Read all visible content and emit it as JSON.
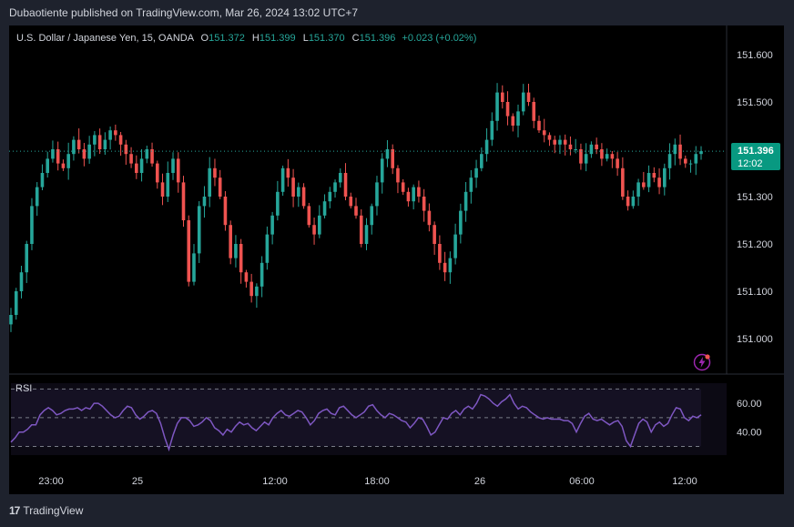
{
  "header": {
    "publisher_line": "Dubaotiente published on TradingView.com, Mar 26, 2024 13:02 UTC+7"
  },
  "legend": {
    "symbol": "U.S. Dollar / Japanese Yen, 15, OANDA",
    "o_label": "O",
    "o_value": "151.372",
    "h_label": "H",
    "h_value": "151.399",
    "l_label": "L",
    "l_value": "151.370",
    "c_label": "C",
    "c_value": "151.396",
    "change": "+0.023 (+0.02%)"
  },
  "price_tag": {
    "price": "151.396",
    "countdown": "12:02"
  },
  "rsi": {
    "label": "RSI"
  },
  "footer": {
    "brand": "TradingView"
  },
  "colors": {
    "up": "#26a69a",
    "down": "#ef5350",
    "rsi_line": "#7e57c2",
    "background": "#000000",
    "frame": "#1e222d",
    "text": "#d1d4dc"
  },
  "chart_data": [
    {
      "type": "candlestick",
      "title": "U.S. Dollar / Japanese Yen, 15, OANDA",
      "y_ticks": [
        "151.600",
        "151.500",
        "151.300",
        "151.200",
        "151.100",
        "151.000"
      ],
      "ylim": [
        150.93,
        151.68
      ],
      "x_ticks": [
        "23:00",
        "25",
        "12:00",
        "18:00",
        "26",
        "06:00",
        "12:00"
      ],
      "last_price": 151.396,
      "last_price_line": "dotted",
      "close_series": [
        151.05,
        151.1,
        151.14,
        151.2,
        151.28,
        151.32,
        151.35,
        151.38,
        151.4,
        151.37,
        151.36,
        151.39,
        151.42,
        151.4,
        151.38,
        151.41,
        151.43,
        151.4,
        151.42,
        151.44,
        151.43,
        151.41,
        151.39,
        151.37,
        151.35,
        151.38,
        151.4,
        151.37,
        151.33,
        151.3,
        151.35,
        151.38,
        151.33,
        151.25,
        151.12,
        151.18,
        151.28,
        151.3,
        151.36,
        151.34,
        151.3,
        151.24,
        151.17,
        151.2,
        151.14,
        151.12,
        151.09,
        151.11,
        151.16,
        151.22,
        151.26,
        151.31,
        151.36,
        151.34,
        151.3,
        151.32,
        151.28,
        151.24,
        151.22,
        151.26,
        151.29,
        151.31,
        151.33,
        151.35,
        151.3,
        151.28,
        151.26,
        151.2,
        151.24,
        151.28,
        151.33,
        151.38,
        151.4,
        151.36,
        151.33,
        151.31,
        151.29,
        151.32,
        151.3,
        151.27,
        151.24,
        151.2,
        151.16,
        151.14,
        151.17,
        151.22,
        151.27,
        151.31,
        151.34,
        151.36,
        151.39,
        151.42,
        151.46,
        151.52,
        151.5,
        151.47,
        151.45,
        151.48,
        151.52,
        151.5,
        151.46,
        151.44,
        151.43,
        151.42,
        151.41,
        151.42,
        151.41,
        151.4,
        151.4,
        151.37,
        151.39,
        151.41,
        151.4,
        151.38,
        151.39,
        151.38,
        151.36,
        151.3,
        151.28,
        151.3,
        151.33,
        151.32,
        151.35,
        151.34,
        151.32,
        151.36,
        151.39,
        151.41,
        151.38,
        151.37,
        151.37,
        151.39,
        151.396
      ]
    },
    {
      "type": "line",
      "name": "RSI",
      "y_ticks": [
        "60.00",
        "40.00"
      ],
      "ylim": [
        24,
        74
      ],
      "bands": [
        30,
        50,
        70
      ],
      "values": [
        33,
        36,
        40,
        40,
        42,
        45,
        45,
        52,
        55,
        57,
        55,
        52,
        53,
        55,
        56,
        56,
        57,
        55,
        57,
        56,
        60,
        60,
        58,
        55,
        52,
        50,
        51,
        55,
        58,
        57,
        52,
        49,
        51,
        54,
        55,
        53,
        46,
        36,
        28,
        38,
        46,
        50,
        50,
        48,
        44,
        45,
        47,
        50,
        48,
        43,
        41,
        38,
        42,
        40,
        44,
        47,
        45,
        46,
        43,
        41,
        44,
        47,
        45,
        50,
        53,
        55,
        52,
        51,
        53,
        55,
        54,
        50,
        45,
        48,
        53,
        55,
        56,
        53,
        52,
        57,
        58,
        55,
        52,
        50,
        52,
        54,
        58,
        59,
        55,
        52,
        50,
        53,
        52,
        50,
        48,
        47,
        43,
        46,
        50,
        49,
        44,
        38,
        40,
        45,
        50,
        49,
        53,
        55,
        52,
        56,
        58,
        56,
        60,
        66,
        65,
        63,
        60,
        58,
        61,
        63,
        66,
        60,
        56,
        58,
        57,
        54,
        52,
        50,
        49,
        50,
        49,
        49,
        49,
        48,
        48,
        46,
        40,
        46,
        51,
        53,
        49,
        48,
        49,
        47,
        45,
        47,
        48,
        44,
        34,
        30,
        38,
        46,
        49,
        47,
        40,
        45,
        47,
        44,
        46,
        52,
        57,
        56,
        50,
        48,
        51,
        50,
        52
      ]
    }
  ]
}
